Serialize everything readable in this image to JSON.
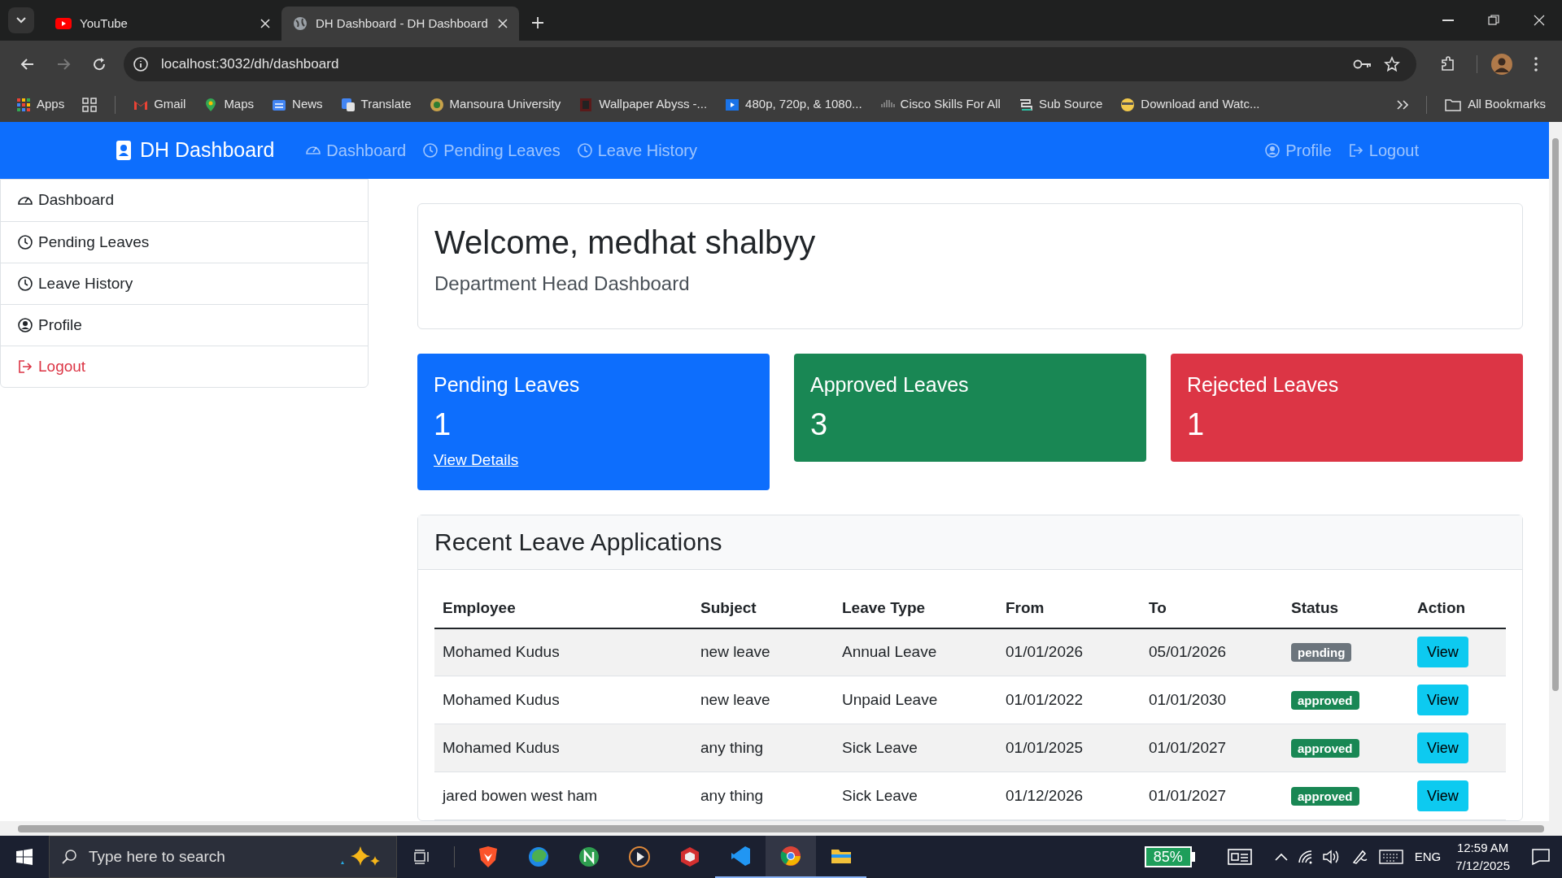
{
  "browser": {
    "tabs": [
      {
        "title": "YouTube",
        "kind": "youtube",
        "selected": false
      },
      {
        "title": "DH Dashboard - DH Dashboard",
        "kind": "globe",
        "selected": true
      }
    ],
    "url": "localhost:3032/dh/dashboard",
    "bookmarks": [
      {
        "label": "Apps",
        "kind": "apps"
      },
      {
        "label": "Gmail",
        "kind": "gmail"
      },
      {
        "label": "Maps",
        "kind": "maps"
      },
      {
        "label": "News",
        "kind": "news"
      },
      {
        "label": "Translate",
        "kind": "translate"
      },
      {
        "label": "Mansoura University",
        "kind": "seal"
      },
      {
        "label": "Wallpaper Abyss -...",
        "kind": "wallpaper"
      },
      {
        "label": "480p, 720p, & 1080...",
        "kind": "video"
      },
      {
        "label": "Cisco Skills For All",
        "kind": "cisco"
      },
      {
        "label": "Sub Source",
        "kind": "sub"
      },
      {
        "label": "Download and Watc...",
        "kind": "minion"
      }
    ],
    "all_bookmarks": "All Bookmarks"
  },
  "navbar": {
    "brand": "DH Dashboard",
    "links": [
      {
        "label": "Dashboard",
        "kind": "gauge"
      },
      {
        "label": "Pending Leaves",
        "kind": "clock"
      },
      {
        "label": "Leave History",
        "kind": "clock"
      }
    ],
    "right_links": [
      {
        "label": "Profile",
        "kind": "person"
      },
      {
        "label": "Logout",
        "kind": "logout"
      }
    ]
  },
  "sidebar": {
    "items": [
      {
        "label": "Dashboard",
        "kind": "gauge",
        "danger": false
      },
      {
        "label": "Pending Leaves",
        "kind": "clock",
        "danger": false
      },
      {
        "label": "Leave History",
        "kind": "clock",
        "danger": false
      },
      {
        "label": "Profile",
        "kind": "person",
        "danger": false
      },
      {
        "label": "Logout",
        "kind": "logout",
        "danger": true
      }
    ]
  },
  "welcome": {
    "title": "Welcome, medhat shalbyy",
    "subtitle": "Department Head Dashboard"
  },
  "stats": [
    {
      "title": "Pending Leaves",
      "count": "1",
      "link": "View Details",
      "color": "#0d6efd"
    },
    {
      "title": "Approved Leaves",
      "count": "3",
      "color": "#198754"
    },
    {
      "title": "Rejected Leaves",
      "count": "1",
      "color": "#dc3545"
    }
  ],
  "recent": {
    "title": "Recent Leave Applications",
    "columns": [
      "Employee",
      "Subject",
      "Leave Type",
      "From",
      "To",
      "Status",
      "Action"
    ],
    "rows": [
      {
        "cells": [
          "Mohamed Kudus",
          "new leave",
          "Annual Leave",
          "01/01/2026",
          "05/01/2026"
        ],
        "status": {
          "label": "pending",
          "kind": "secondary"
        },
        "action": "View"
      },
      {
        "cells": [
          "Mohamed Kudus",
          "new leave",
          "Unpaid Leave",
          "01/01/2022",
          "01/01/2030"
        ],
        "status": {
          "label": "approved",
          "kind": "success"
        },
        "action": "View"
      },
      {
        "cells": [
          "Mohamed Kudus",
          "any thing",
          "Sick Leave",
          "01/01/2025",
          "01/01/2027"
        ],
        "status": {
          "label": "approved",
          "kind": "success"
        },
        "action": "View"
      },
      {
        "cells": [
          "jared bowen west ham",
          "any thing",
          "Sick Leave",
          "01/12/2026",
          "01/01/2027"
        ],
        "status": {
          "label": "approved",
          "kind": "success"
        },
        "action": "View"
      }
    ]
  },
  "taskbar": {
    "search_placeholder": "Type here to search",
    "battery": "85%",
    "language": "ENG",
    "time": "12:59 AM",
    "date": "7/12/2025"
  }
}
